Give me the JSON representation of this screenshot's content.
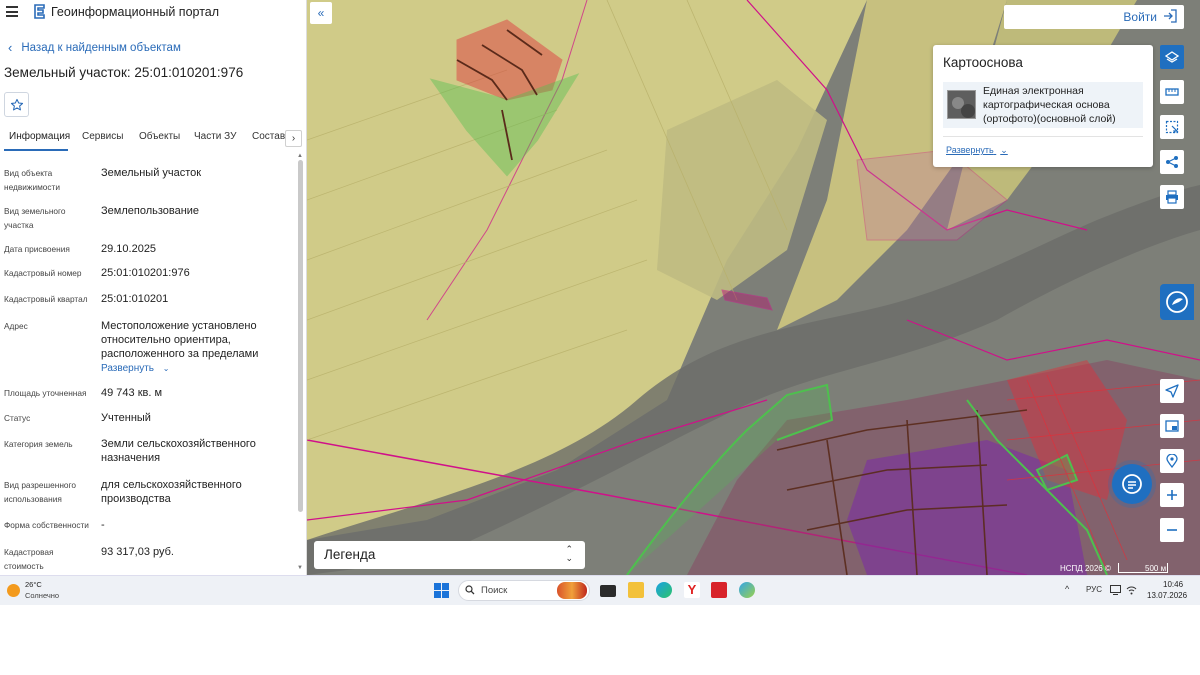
{
  "header": {
    "portal_name": "Геоинформационный портал"
  },
  "back_link": "Назад к найденным объектам",
  "title": "Земельный участок: 25:01:010201:976",
  "tabs": [
    {
      "label": "Информация"
    },
    {
      "label": "Сервисы"
    },
    {
      "label": "Объекты"
    },
    {
      "label": "Части ЗУ"
    },
    {
      "label": "Состав"
    }
  ],
  "tab_next": "›",
  "info": {
    "rows": [
      {
        "label": "Вид объекта недвижимости",
        "value": "Земельный участок"
      },
      {
        "label": "Вид земельного участка",
        "value": "Землепользование"
      },
      {
        "label": "Дата присвоения",
        "value": "29.10.2025"
      },
      {
        "label": "Кадастровый номер",
        "value": "25:01:010201:976"
      },
      {
        "label": "Кадастровый квартал",
        "value": "25:01:010201"
      },
      {
        "label": "Адрес",
        "value": "Местоположение установлено относительно ориентира, расположенного за пределами"
      },
      {
        "label": "Площадь уточненная",
        "value": "49 743 кв. м"
      },
      {
        "label": "Статус",
        "value": "Учтенный"
      },
      {
        "label": "Категория земель",
        "value": "Земли сельскохозяйственного назначения"
      },
      {
        "label": "Вид разрешенного использования",
        "value": "для сельскохозяйственного производства"
      },
      {
        "label": "Форма собственности",
        "value": "-"
      },
      {
        "label": "Кадастровая стоимость",
        "value": "93 317,03 руб."
      }
    ],
    "expand_label": "Развернуть"
  },
  "login": {
    "label": "Войти"
  },
  "basemap": {
    "title": "Картооснова",
    "item_name": "Единая электронная картографическая основа (ортофото)(основной слой)",
    "expand_label": "Развернуть"
  },
  "legend": {
    "label": "Легенда"
  },
  "map_footer": {
    "copyright": "НСПД 2026 ©",
    "scale": "500 м"
  },
  "taskbar": {
    "weather_temp": "26°C",
    "weather_desc": "Солнечно",
    "search_placeholder": "Поиск",
    "language": "РУС",
    "time": "10:46",
    "date": "13.07.2026"
  },
  "colors": {
    "accent": "#2a6bb8",
    "toolbar_blue": "#1f6fc0",
    "parcel_red": "#e0303a",
    "parcel_green": "#4ec04e",
    "boundary_magenta": "#d0108a",
    "boundary_brown": "#5a2a1a"
  },
  "icons": {
    "menu": "hamburger-icon",
    "back": "chevron-left-icon",
    "favorite": "star-icon",
    "login": "sign-in-icon",
    "layers": "layers-icon",
    "ruler": "ruler-icon",
    "select": "select-area-icon",
    "share": "share-icon",
    "print": "printer-icon",
    "locate": "navigation-arrow-icon",
    "minimap": "minimap-icon",
    "geolocation": "geolocation-icon",
    "zoom_in": "plus-icon",
    "zoom_out": "minus-icon",
    "help": "help-chat-icon",
    "chat": "chat-bubble-icon"
  }
}
